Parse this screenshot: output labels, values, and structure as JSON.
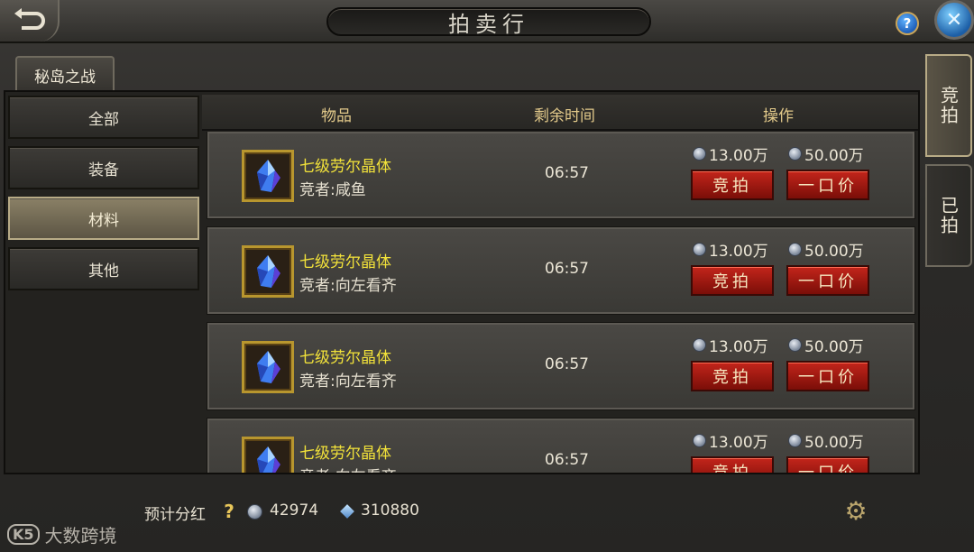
{
  "window": {
    "title": "拍卖行"
  },
  "category_tab": {
    "label": "秘岛之战"
  },
  "sidebar": {
    "items": [
      {
        "label": "全部",
        "active": false
      },
      {
        "label": "装备",
        "active": false
      },
      {
        "label": "材料",
        "active": true
      },
      {
        "label": "其他",
        "active": false
      }
    ]
  },
  "table": {
    "headers": {
      "item": "物品",
      "time_left": "剩余时间",
      "action": "操作"
    },
    "rows": [
      {
        "item_name": "七级劳尔晶体",
        "bidder": "竞者:咸鱼",
        "time_left": "06:57",
        "bid_price": "13.00万",
        "buyout_price": "50.00万",
        "bid_label": "竞拍",
        "buyout_label": "一口价"
      },
      {
        "item_name": "七级劳尔晶体",
        "bidder": "竞者:向左看齐",
        "time_left": "06:57",
        "bid_price": "13.00万",
        "buyout_price": "50.00万",
        "bid_label": "竞拍",
        "buyout_label": "一口价"
      },
      {
        "item_name": "七级劳尔晶体",
        "bidder": "竞者:向左看齐",
        "time_left": "06:57",
        "bid_price": "13.00万",
        "buyout_price": "50.00万",
        "bid_label": "竞拍",
        "buyout_label": "一口价"
      },
      {
        "item_name": "七级劳尔晶体",
        "bidder": "竞者:向左看齐",
        "time_left": "06:57",
        "bid_price": "13.00万",
        "buyout_price": "50.00万",
        "bid_label": "竞拍",
        "buyout_label": "一口价"
      }
    ]
  },
  "right_tabs": [
    {
      "label": "竞拍",
      "active": true
    },
    {
      "label": "已拍",
      "active": false
    }
  ],
  "footer": {
    "dividend_label": "预计分红",
    "help_glyph": "?",
    "silver_amount": "42974",
    "diamond_amount": "310880"
  },
  "watermark": {
    "logo": "K5",
    "text": "大数跨境"
  },
  "icons": {
    "back": "back-arrow-icon",
    "help": "help-icon",
    "close": "close-icon",
    "item": "blue-crystal-icon",
    "silver": "silver-coin-icon",
    "diamond": "diamond-icon",
    "settings": "gear-icon"
  },
  "colors": {
    "item_name": "#f2e23a",
    "header_text": "#e2c98a",
    "button_red": "#c3251b"
  }
}
